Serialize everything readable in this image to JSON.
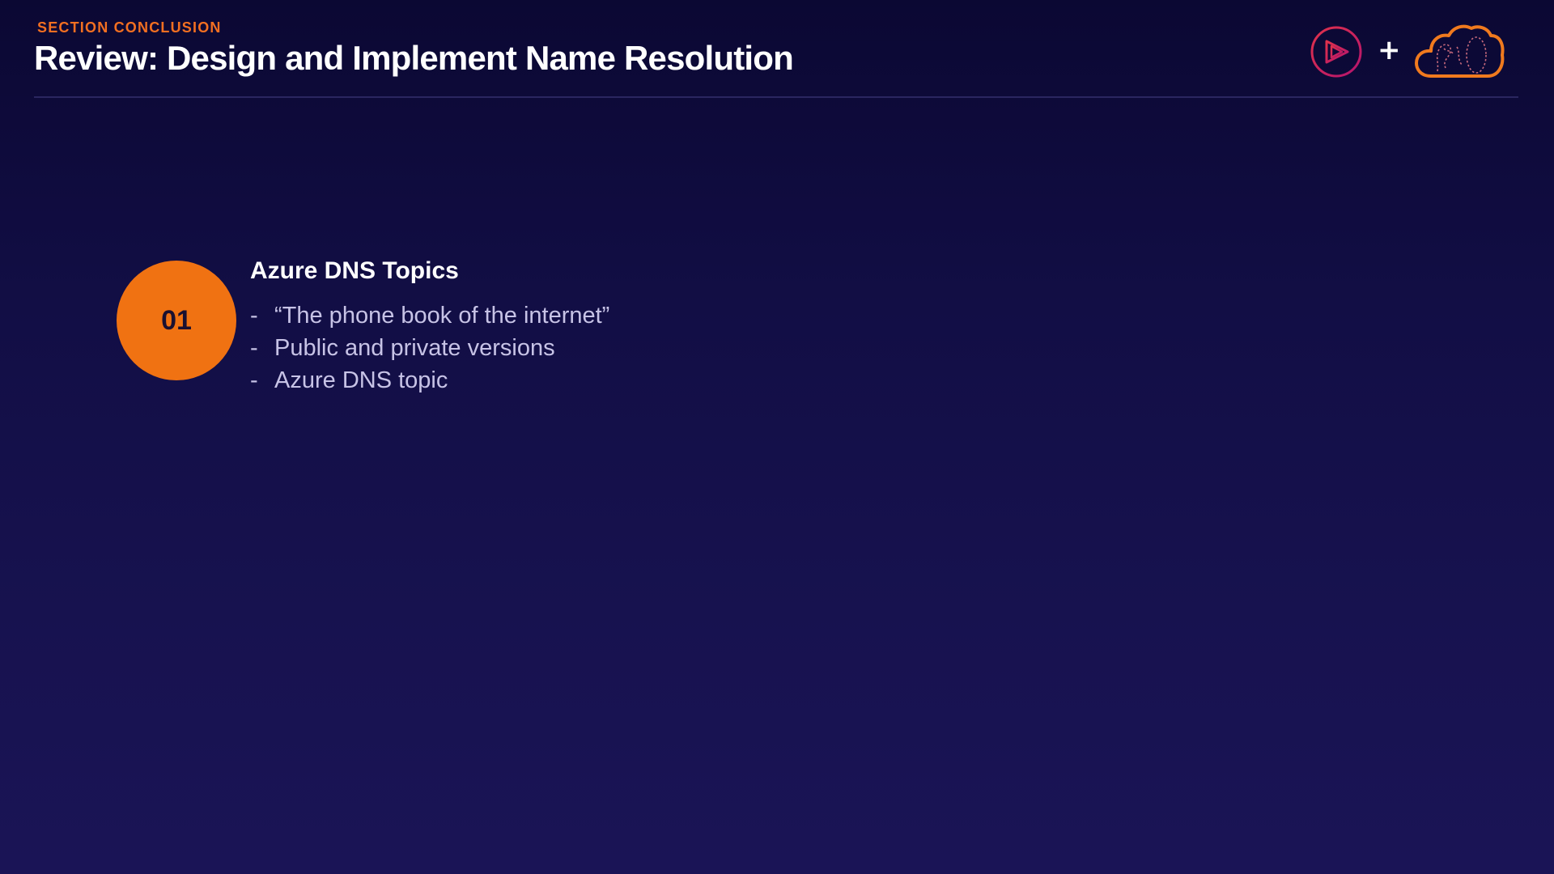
{
  "header": {
    "section_label": "SECTION CONCLUSION",
    "title": "Review: Design and Implement Name Resolution",
    "logos": {
      "left": "pluralsight-play-icon",
      "separator": "+",
      "right": "cloud-icon"
    }
  },
  "items": [
    {
      "number": "01",
      "heading": "Azure DNS Topics",
      "bullet_marker": "-",
      "bullets": [
        "“The phone book of the internet”",
        "Public and private versions",
        "Azure DNS topic"
      ]
    }
  ],
  "colors": {
    "accent": "#f26f21",
    "badge": "#f07212",
    "background_top": "#0b0833",
    "background_bottom": "#1a1456",
    "text": "#ffffff",
    "muted_text": "#c7c3e6"
  }
}
